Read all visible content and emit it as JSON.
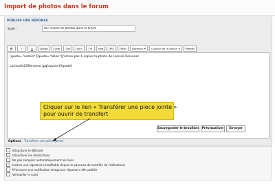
{
  "page": {
    "title": "Import de photos dans le forum"
  },
  "form": {
    "section_title": "PUBLIER UNE RÉPONSE",
    "subject_label": "Sujet :",
    "subject_value": "Re: Import de photos dans le forum"
  },
  "toolbar": {
    "buttons": [
      "B",
      "i",
      "u",
      "Quote",
      "Code",
      "List",
      "List=",
      "[*]",
      "Img",
      "URL",
      "Flash"
    ],
    "font_size_select": "Normale",
    "font_color_select": "Couleur de la police",
    "close_tags_label": "Fermer"
  },
  "editor": {
    "line1": "[quote=\"admin\"][quote=\"Néon\"]J'arrive pas à copier la photo de Larissa Reisener.",
    "line2": "Larissa%20Reisener.jpg[/quote][/quote]"
  },
  "callout": {
    "line1": "Cliquer sur le lien « Transférer une piece jointe »",
    "line2": "pour ouvrir de transfert",
    "color": "#f3dc3a"
  },
  "actions": {
    "save_draft": "Sauvegarder le brouillon",
    "preview": "Prévisualiser",
    "submit": "Envoyer"
  },
  "tabs": {
    "options": "Options",
    "attach": "Transférer une pièce jointe"
  },
  "options": [
    {
      "label": "Désactiver le BBCode",
      "checked": false
    },
    {
      "label": "Désactiver les émoticônes",
      "checked": false
    },
    {
      "label": "Ne pas compiler automatiquement les liens",
      "checked": false
    },
    {
      "label": "Insérer une signature (modifiable depuis le panneau de contrôle de l'utilisateur)",
      "checked": true
    },
    {
      "label": "M'envoyer une notification lorsqu'une réponse a été publiée",
      "checked": false
    },
    {
      "label": "Verrouiller le sujet",
      "checked": false
    }
  ],
  "colors": {
    "title": "#c43a22",
    "link": "#1f5d94",
    "panel": "#ececec"
  }
}
